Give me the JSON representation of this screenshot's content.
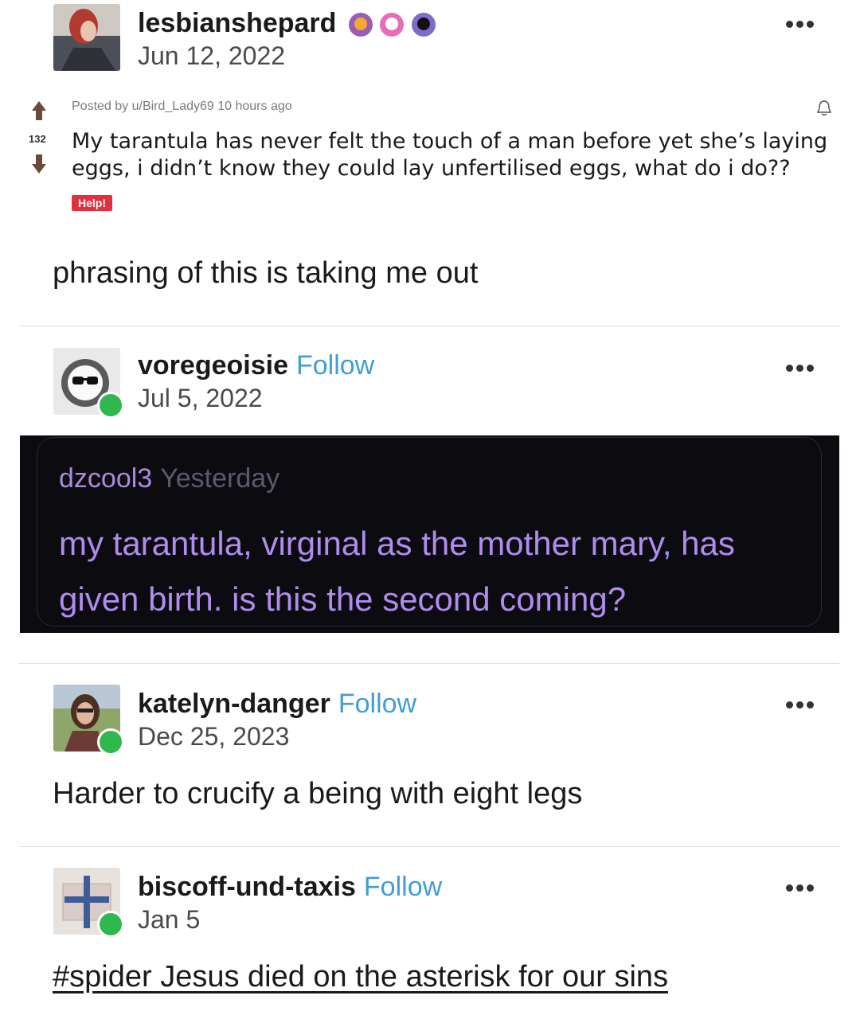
{
  "post1": {
    "username": "lesbianshepard",
    "date": "Jun 12, 2022",
    "body": "phrasing of this is taking me out"
  },
  "reddit": {
    "meta": "Posted by u/Bird_Lady69 10 hours ago",
    "votes": "132",
    "title": "My tarantula has never felt the touch of a man before yet she’s laying eggs, i didn’t know they could lay unfertilised eggs, what do i do??",
    "flair": "Help!"
  },
  "post2": {
    "username": "voregeoisie",
    "follow": "Follow",
    "date": "Jul 5, 2022"
  },
  "comment": {
    "user": "dzcool3",
    "time": "Yesterday",
    "text": "my tarantula, virginal as the mother mary, has given birth. is this the second coming?"
  },
  "post3": {
    "username": "katelyn-danger",
    "follow": "Follow",
    "date": "Dec 25, 2023",
    "body": "Harder to crucify a being with eight legs"
  },
  "post4": {
    "username": "biscoff-und-taxis",
    "follow": "Follow",
    "date": "Jan 5",
    "tag": "#spider Jesus died on the asterisk for our sins"
  },
  "colors": {
    "follow": "#3f9ed6",
    "reblog_badge": "#2eb84d",
    "comment_text": "#b08cf0",
    "dark_bg": "#0c0b10"
  }
}
